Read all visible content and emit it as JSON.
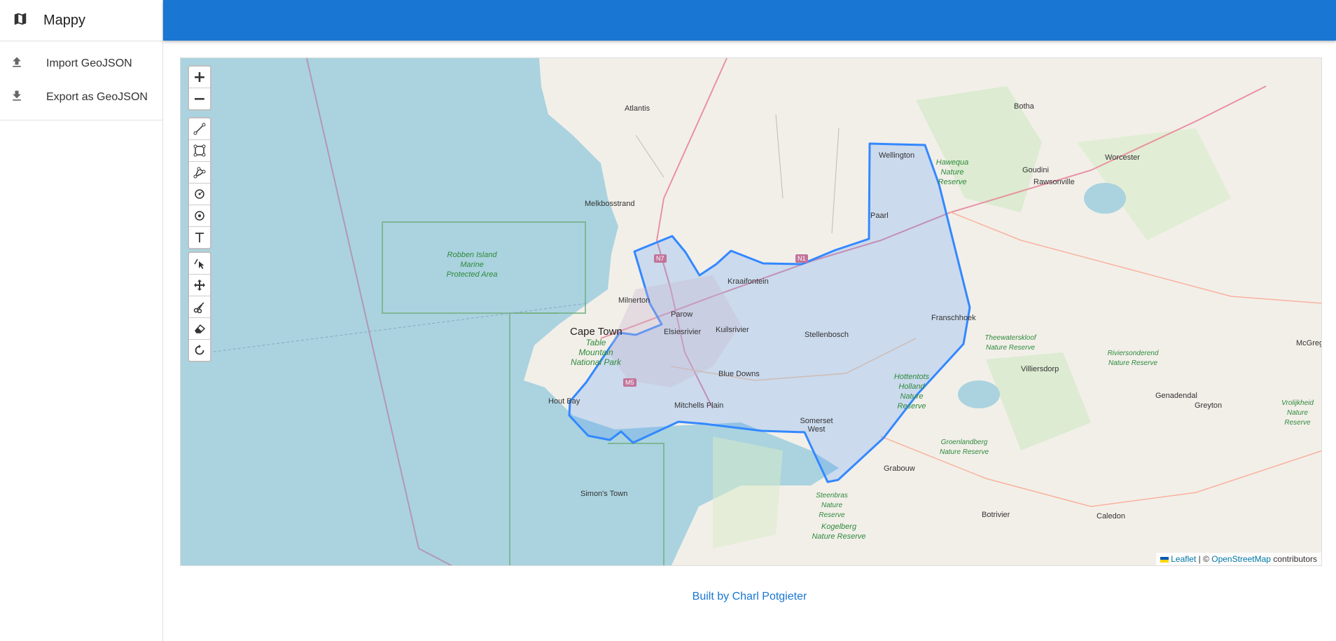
{
  "app": {
    "title": "Mappy",
    "icon": "map-icon"
  },
  "menu": [
    {
      "label": "Import GeoJSON",
      "icon": "upload-icon"
    },
    {
      "label": "Export as GeoJSON",
      "icon": "download-icon"
    }
  ],
  "colors": {
    "appbar": "#1976d2",
    "polygon_stroke": "#3388ff",
    "water": "#aad3df",
    "land": "#f2efe9"
  },
  "map": {
    "zoom_in": "+",
    "zoom_out": "−",
    "draw_tools": [
      "draw-polyline-icon",
      "draw-rectangle-icon",
      "draw-polygon-icon",
      "draw-circle-icon",
      "draw-circle-marker-icon",
      "draw-text-icon"
    ],
    "edit_tools": [
      "edit-layers-icon",
      "drag-layers-icon",
      "cut-layers-icon",
      "remove-layers-icon",
      "rotate-layers-icon"
    ],
    "labels": {
      "atlantis": "Atlantis",
      "melkbosstrand": "Melkbosstrand",
      "milnerton": "Milnerton",
      "cape_town": "Cape Town",
      "parow": "Parow",
      "elsiesrivier": "Elsiesrivier",
      "kuilsrivier": "Kuilsrivier",
      "kraaifontein": "Kraaifontein",
      "blue_downs": "Blue Downs",
      "mitchells_plain": "Mitchells Plain",
      "hout_bay": "Hout Bay",
      "simons_town": "Simon's Town",
      "stellenbosch": "Stellenbosch",
      "somerset_west": "Somerset West",
      "paarl": "Paarl",
      "wellington": "Wellington",
      "franschhoek": "Franschhoek",
      "grabouw": "Grabouw",
      "villiersdorp": "Villiersdorp",
      "genadendal": "Genadendal",
      "greyton": "Greyton",
      "botha": "Botha",
      "worcester": "Worcester",
      "goudini": "Goudini",
      "rawsonville": "Rawsonville",
      "botrivier": "Botrivier",
      "caledon": "Caledon",
      "mcgregor": "McGreg"
    },
    "parks": {
      "robben": "Robben Island Marine Protected Area",
      "table_mountain": "Table Mountain National Park",
      "hawequa": "Hawequa Nature Reserve",
      "hottentots": "Hottentots Holland Nature Reserve",
      "theewaterskloof": "Theewaterskloof Nature Reserve",
      "riviersonderend": "Riviersonderend Nature Reserve",
      "groenlandberg": "Groenlandberg Nature Reserve",
      "steenbras": "Steenbras Nature Reserve",
      "kogelberg": "Kogelberg Nature Reserve",
      "vrolijkheid": "Vrolijkheid Nature Reserve"
    },
    "shields": {
      "n7": "N7",
      "n1": "N1",
      "m5": "M5"
    },
    "attribution": {
      "leaflet": "Leaflet",
      "separator": " | © ",
      "osm": "OpenStreetMap",
      "suffix": " contributors"
    }
  },
  "footer": {
    "text": "Built by Charl Potgieter"
  }
}
